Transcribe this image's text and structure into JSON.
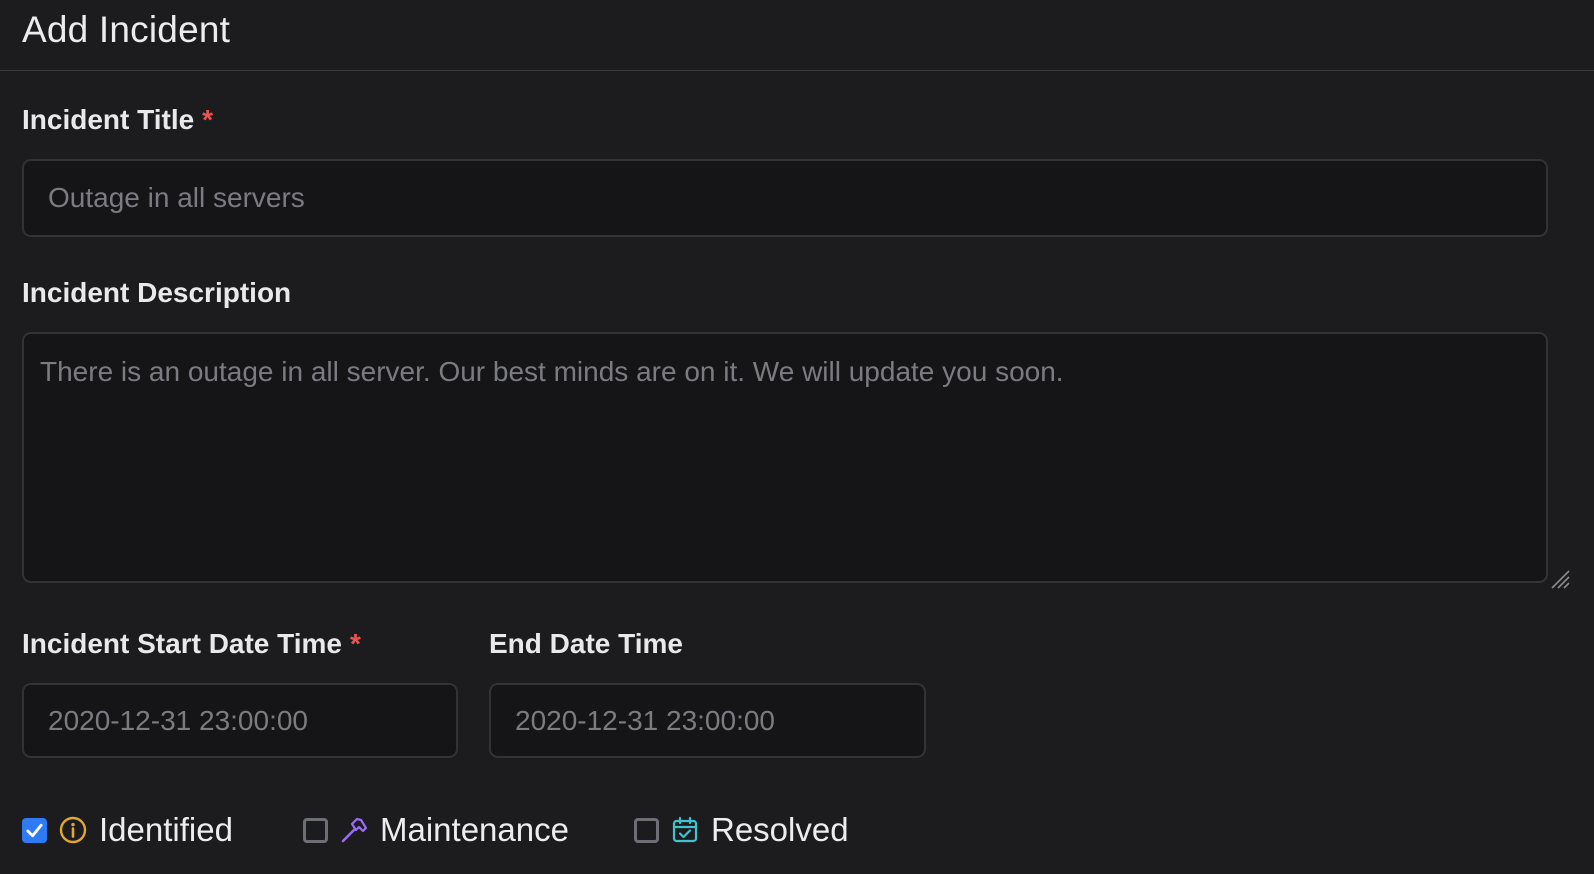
{
  "page": {
    "title": "Add Incident"
  },
  "form": {
    "title_field": {
      "label": "Incident Title",
      "required_mark": "*",
      "placeholder": "Outage in all servers",
      "value": ""
    },
    "description_field": {
      "label": "Incident Description",
      "placeholder": "There is an outage in all server. Our best minds are on it. We will update you soon.",
      "value": ""
    },
    "start_field": {
      "label": "Incident Start Date Time",
      "required_mark": "*",
      "placeholder": "2020-12-31 23:00:00",
      "value": ""
    },
    "end_field": {
      "label": "End Date Time",
      "placeholder": "2020-12-31 23:00:00",
      "value": ""
    }
  },
  "statuses": [
    {
      "label": "Identified",
      "checked": true,
      "icon": "info-icon",
      "color": "#e0a82e"
    },
    {
      "label": "Maintenance",
      "checked": false,
      "icon": "hammer-icon",
      "color": "#9b6cf0"
    },
    {
      "label": "Resolved",
      "checked": false,
      "icon": "calendar-check-icon",
      "color": "#3fc3cf"
    }
  ],
  "colors": {
    "accent": "#2f7bf5",
    "required": "#ef5350",
    "background": "#1c1c1f"
  }
}
